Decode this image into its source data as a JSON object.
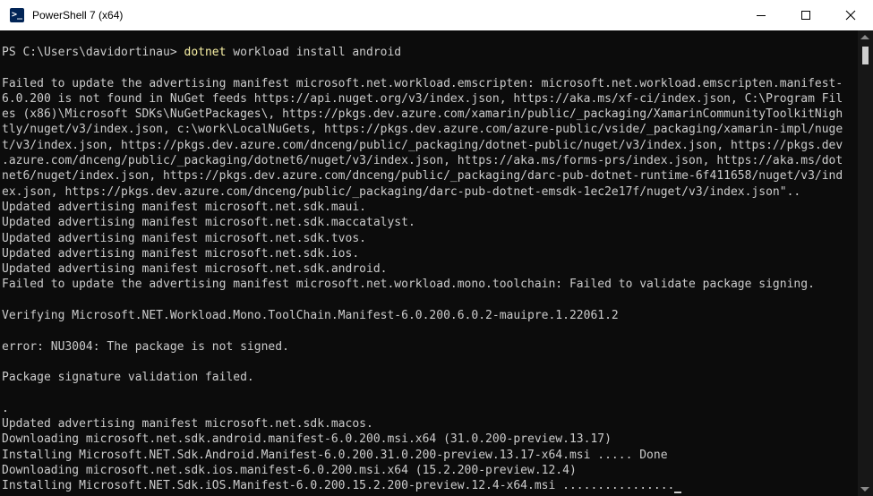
{
  "window": {
    "title": "PowerShell 7 (x64)",
    "app_icon_glyph": ">_",
    "controls": [
      "minimize",
      "maximize",
      "close"
    ]
  },
  "terminal": {
    "prompt": "PS C:\\Users\\davidortinau> ",
    "command": "dotnet",
    "command_args": " workload install android",
    "lines": [
      "",
      "Failed to update the advertising manifest microsoft.net.workload.emscripten: microsoft.net.workload.emscripten.manifest-",
      "6.0.200 is not found in NuGet feeds https://api.nuget.org/v3/index.json, https://aka.ms/xf-ci/index.json, C:\\Program Fil",
      "es (x86)\\Microsoft SDKs\\NuGetPackages\\, https://pkgs.dev.azure.com/xamarin/public/_packaging/XamarinCommunityToolkitNigh",
      "tly/nuget/v3/index.json, c:\\work\\LocalNuGets, https://pkgs.dev.azure.com/azure-public/vside/_packaging/xamarin-impl/nuge",
      "t/v3/index.json, https://pkgs.dev.azure.com/dnceng/public/_packaging/dotnet-public/nuget/v3/index.json, https://pkgs.dev",
      ".azure.com/dnceng/public/_packaging/dotnet6/nuget/v3/index.json, https://aka.ms/forms-prs/index.json, https://aka.ms/dot",
      "net6/nuget/index.json, https://pkgs.dev.azure.com/dnceng/public/_packaging/darc-pub-dotnet-runtime-6f411658/nuget/v3/ind",
      "ex.json, https://pkgs.dev.azure.com/dnceng/public/_packaging/darc-pub-dotnet-emsdk-1ec2e17f/nuget/v3/index.json\"..",
      "Updated advertising manifest microsoft.net.sdk.maui.",
      "Updated advertising manifest microsoft.net.sdk.maccatalyst.",
      "Updated advertising manifest microsoft.net.sdk.tvos.",
      "Updated advertising manifest microsoft.net.sdk.ios.",
      "Updated advertising manifest microsoft.net.sdk.android.",
      "Failed to update the advertising manifest microsoft.net.workload.mono.toolchain: Failed to validate package signing.",
      "",
      "Verifying Microsoft.NET.Workload.Mono.ToolChain.Manifest-6.0.200.6.0.2-mauipre.1.22061.2",
      "",
      "error: NU3004: The package is not signed.",
      "",
      "Package signature validation failed.",
      "",
      ".",
      "Updated advertising manifest microsoft.net.sdk.macos.",
      "Downloading microsoft.net.sdk.android.manifest-6.0.200.msi.x64 (31.0.200-preview.13.17)",
      "Installing Microsoft.NET.Sdk.Android.Manifest-6.0.200.31.0.200-preview.13.17-x64.msi ..... Done",
      "Downloading microsoft.net.sdk.ios.manifest-6.0.200.msi.x64 (15.2.200-preview.12.4)",
      "Installing Microsoft.NET.Sdk.iOS.Manifest-6.0.200.15.2.200-preview.12.4-x64.msi ................"
    ]
  },
  "colors": {
    "background": "#0c0c0c",
    "foreground": "#cccccc",
    "command": "#f9f1a5",
    "titlebar": "#ffffff"
  }
}
